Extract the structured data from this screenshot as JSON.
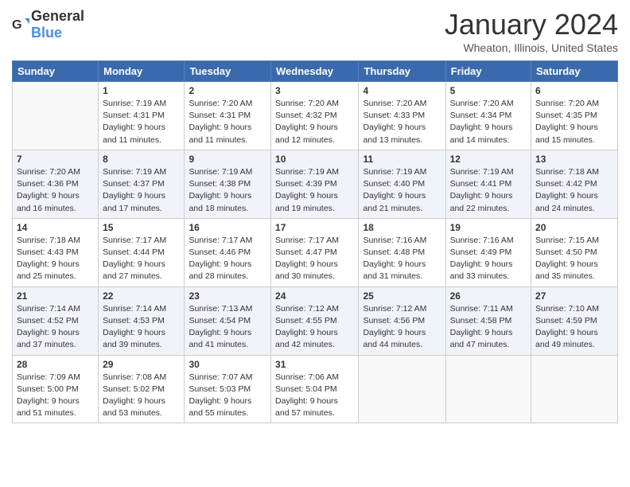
{
  "header": {
    "logo": {
      "general": "General",
      "blue": "Blue"
    },
    "title": "January 2024",
    "location": "Wheaton, Illinois, United States"
  },
  "weekdays": [
    "Sunday",
    "Monday",
    "Tuesday",
    "Wednesday",
    "Thursday",
    "Friday",
    "Saturday"
  ],
  "weeks": [
    [
      {
        "day": null,
        "info": ""
      },
      {
        "day": "1",
        "info": "Sunrise: 7:19 AM\nSunset: 4:31 PM\nDaylight: 9 hours\nand 11 minutes."
      },
      {
        "day": "2",
        "info": "Sunrise: 7:20 AM\nSunset: 4:31 PM\nDaylight: 9 hours\nand 11 minutes."
      },
      {
        "day": "3",
        "info": "Sunrise: 7:20 AM\nSunset: 4:32 PM\nDaylight: 9 hours\nand 12 minutes."
      },
      {
        "day": "4",
        "info": "Sunrise: 7:20 AM\nSunset: 4:33 PM\nDaylight: 9 hours\nand 13 minutes."
      },
      {
        "day": "5",
        "info": "Sunrise: 7:20 AM\nSunset: 4:34 PM\nDaylight: 9 hours\nand 14 minutes."
      },
      {
        "day": "6",
        "info": "Sunrise: 7:20 AM\nSunset: 4:35 PM\nDaylight: 9 hours\nand 15 minutes."
      }
    ],
    [
      {
        "day": "7",
        "info": "Sunrise: 7:20 AM\nSunset: 4:36 PM\nDaylight: 9 hours\nand 16 minutes."
      },
      {
        "day": "8",
        "info": "Sunrise: 7:19 AM\nSunset: 4:37 PM\nDaylight: 9 hours\nand 17 minutes."
      },
      {
        "day": "9",
        "info": "Sunrise: 7:19 AM\nSunset: 4:38 PM\nDaylight: 9 hours\nand 18 minutes."
      },
      {
        "day": "10",
        "info": "Sunrise: 7:19 AM\nSunset: 4:39 PM\nDaylight: 9 hours\nand 19 minutes."
      },
      {
        "day": "11",
        "info": "Sunrise: 7:19 AM\nSunset: 4:40 PM\nDaylight: 9 hours\nand 21 minutes."
      },
      {
        "day": "12",
        "info": "Sunrise: 7:19 AM\nSunset: 4:41 PM\nDaylight: 9 hours\nand 22 minutes."
      },
      {
        "day": "13",
        "info": "Sunrise: 7:18 AM\nSunset: 4:42 PM\nDaylight: 9 hours\nand 24 minutes."
      }
    ],
    [
      {
        "day": "14",
        "info": "Sunrise: 7:18 AM\nSunset: 4:43 PM\nDaylight: 9 hours\nand 25 minutes."
      },
      {
        "day": "15",
        "info": "Sunrise: 7:17 AM\nSunset: 4:44 PM\nDaylight: 9 hours\nand 27 minutes."
      },
      {
        "day": "16",
        "info": "Sunrise: 7:17 AM\nSunset: 4:46 PM\nDaylight: 9 hours\nand 28 minutes."
      },
      {
        "day": "17",
        "info": "Sunrise: 7:17 AM\nSunset: 4:47 PM\nDaylight: 9 hours\nand 30 minutes."
      },
      {
        "day": "18",
        "info": "Sunrise: 7:16 AM\nSunset: 4:48 PM\nDaylight: 9 hours\nand 31 minutes."
      },
      {
        "day": "19",
        "info": "Sunrise: 7:16 AM\nSunset: 4:49 PM\nDaylight: 9 hours\nand 33 minutes."
      },
      {
        "day": "20",
        "info": "Sunrise: 7:15 AM\nSunset: 4:50 PM\nDaylight: 9 hours\nand 35 minutes."
      }
    ],
    [
      {
        "day": "21",
        "info": "Sunrise: 7:14 AM\nSunset: 4:52 PM\nDaylight: 9 hours\nand 37 minutes."
      },
      {
        "day": "22",
        "info": "Sunrise: 7:14 AM\nSunset: 4:53 PM\nDaylight: 9 hours\nand 39 minutes."
      },
      {
        "day": "23",
        "info": "Sunrise: 7:13 AM\nSunset: 4:54 PM\nDaylight: 9 hours\nand 41 minutes."
      },
      {
        "day": "24",
        "info": "Sunrise: 7:12 AM\nSunset: 4:55 PM\nDaylight: 9 hours\nand 42 minutes."
      },
      {
        "day": "25",
        "info": "Sunrise: 7:12 AM\nSunset: 4:56 PM\nDaylight: 9 hours\nand 44 minutes."
      },
      {
        "day": "26",
        "info": "Sunrise: 7:11 AM\nSunset: 4:58 PM\nDaylight: 9 hours\nand 47 minutes."
      },
      {
        "day": "27",
        "info": "Sunrise: 7:10 AM\nSunset: 4:59 PM\nDaylight: 9 hours\nand 49 minutes."
      }
    ],
    [
      {
        "day": "28",
        "info": "Sunrise: 7:09 AM\nSunset: 5:00 PM\nDaylight: 9 hours\nand 51 minutes."
      },
      {
        "day": "29",
        "info": "Sunrise: 7:08 AM\nSunset: 5:02 PM\nDaylight: 9 hours\nand 53 minutes."
      },
      {
        "day": "30",
        "info": "Sunrise: 7:07 AM\nSunset: 5:03 PM\nDaylight: 9 hours\nand 55 minutes."
      },
      {
        "day": "31",
        "info": "Sunrise: 7:06 AM\nSunset: 5:04 PM\nDaylight: 9 hours\nand 57 minutes."
      },
      {
        "day": null,
        "info": ""
      },
      {
        "day": null,
        "info": ""
      },
      {
        "day": null,
        "info": ""
      }
    ]
  ]
}
